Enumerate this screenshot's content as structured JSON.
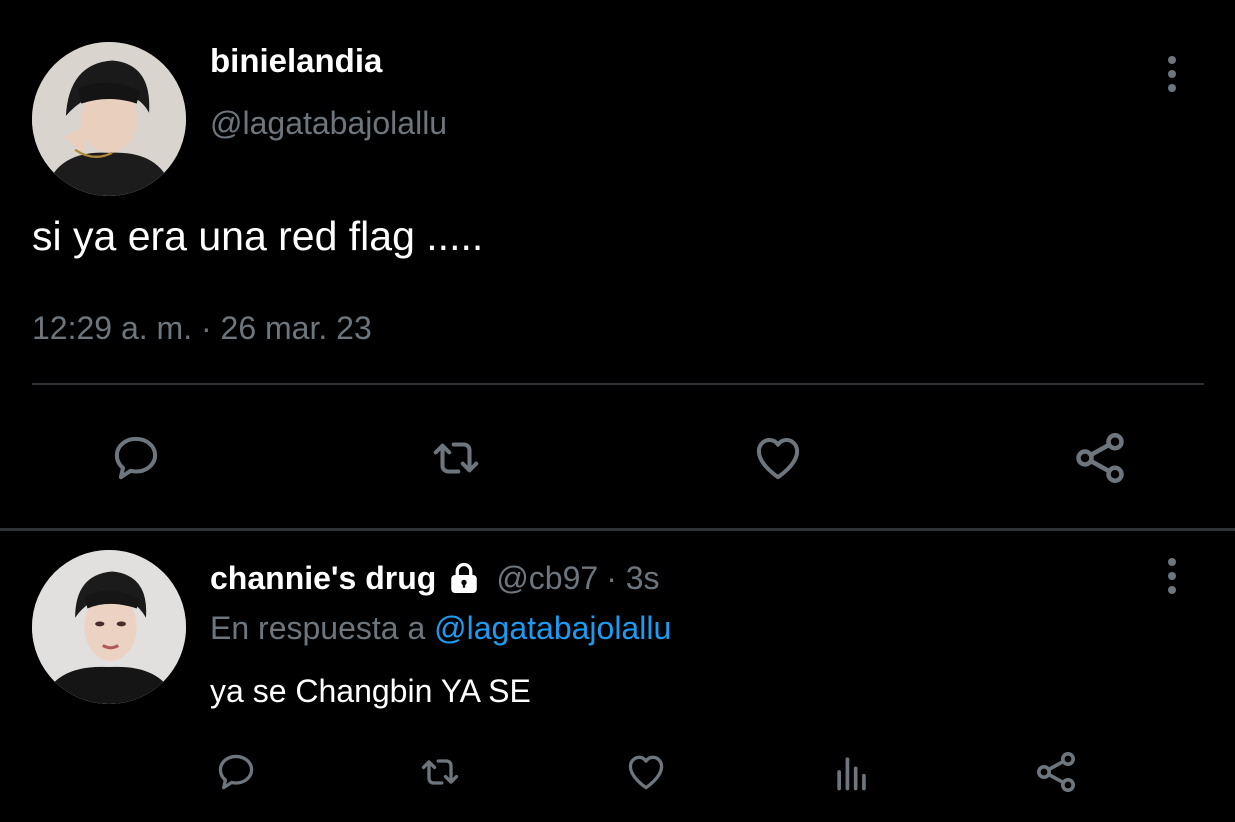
{
  "tweet": {
    "author_name": "binielandia",
    "handle": "@lagatabajolallu",
    "text": "si ya era una red flag .....",
    "timestamp": "12:29 a. m. · 26 mar. 23",
    "actions": [
      "reply-icon",
      "retweet-icon",
      "like-icon",
      "share-icon"
    ]
  },
  "reply": {
    "author_name": "channie's drug",
    "protected_icon": "lock-icon",
    "handle": "@cb97",
    "dot_time": "· 3s",
    "in_reply_prefix": "En respuesta a",
    "in_reply_handle": "@lagatabajolallu",
    "text": "ya se Changbin YA SE",
    "actions": [
      "reply-icon",
      "retweet-icon",
      "like-icon",
      "analytics-icon",
      "share-icon"
    ]
  },
  "colors": {
    "background": "#000000",
    "text": "#ffffff",
    "muted": "#6e767d",
    "link": "#1d9bf0",
    "divider": "#2f3336"
  }
}
